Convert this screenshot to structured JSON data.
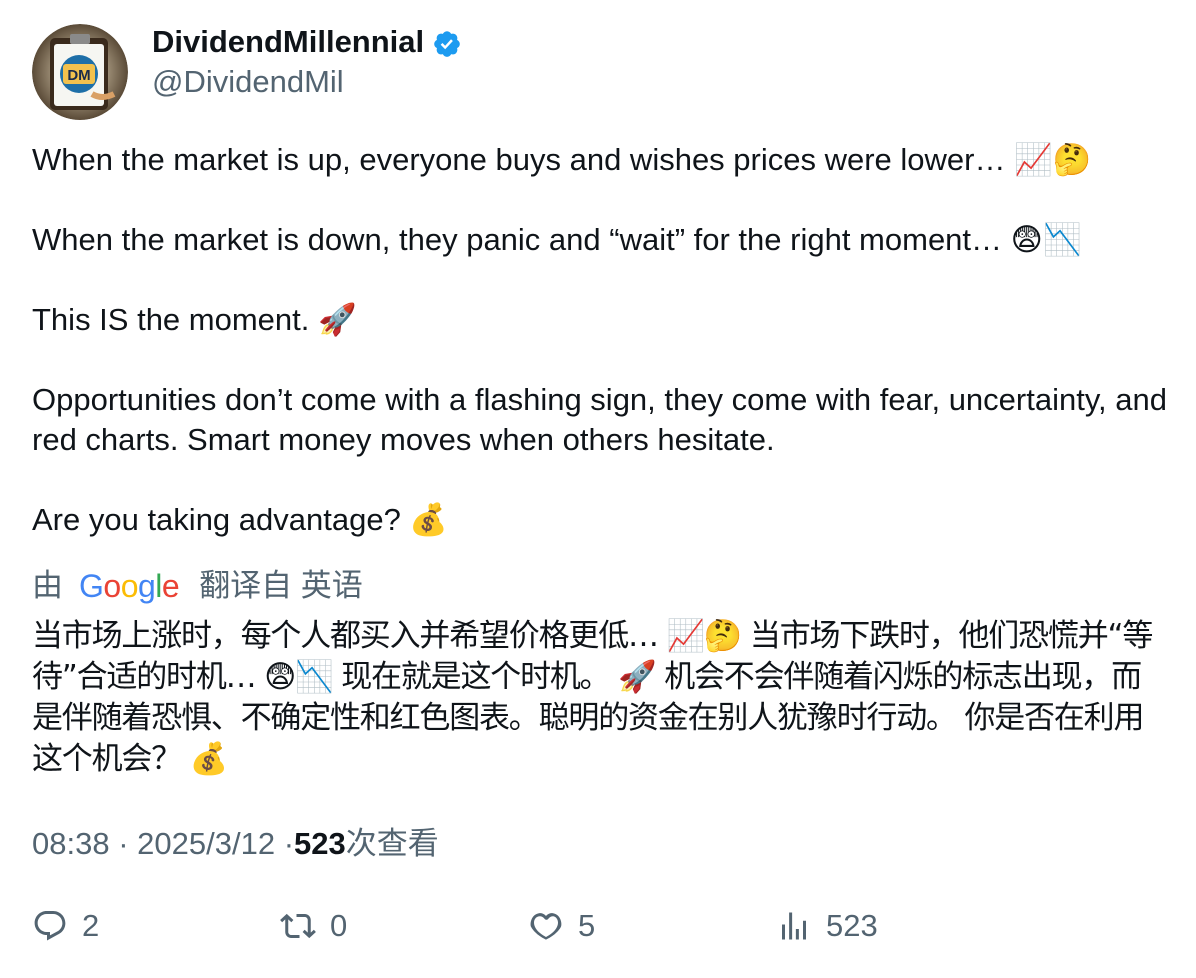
{
  "author": {
    "display_name": "DividendMillennial",
    "handle": "@DividendMil",
    "avatar_text": "DM",
    "verified": true
  },
  "tweet": {
    "paragraphs": [
      "When the market is up, everyone buys and wishes prices were lower… 📈🤔",
      "When the market is down, they panic and “wait” for the right moment… 😨📉",
      "This IS the moment. 🚀",
      "Opportunities don’t come with a flashing sign, they come with fear, uncertainty, and red charts. Smart money moves when others hesitate.",
      "Are you taking advantage? 💰"
    ]
  },
  "translation": {
    "prefix": "由",
    "provider": "Google",
    "suffix": "翻译自 英语",
    "text": "当市场上涨时，每个人都买入并希望价格更低… 📈🤔 当市场下跌时，他们恐慌并“等待”合适的时机… 😨📉 现在就是这个时机。 🚀 机会不会伴随着闪烁的标志出现，而是伴随着恐惧、不确定性和红色图表。聪明的资金在别人犹豫时行动。 你是否在利用这个机会？ 💰"
  },
  "meta": {
    "time": "08:38",
    "separator": "·",
    "date": "2025/3/12",
    "views_count": "523",
    "views_label": "次查看"
  },
  "actions": {
    "reply_count": "2",
    "retweet_count": "0",
    "like_count": "5",
    "views_count": "523"
  },
  "colors": {
    "text": "#0f1419",
    "secondary": "#536471",
    "verified": "#1d9bf0"
  }
}
